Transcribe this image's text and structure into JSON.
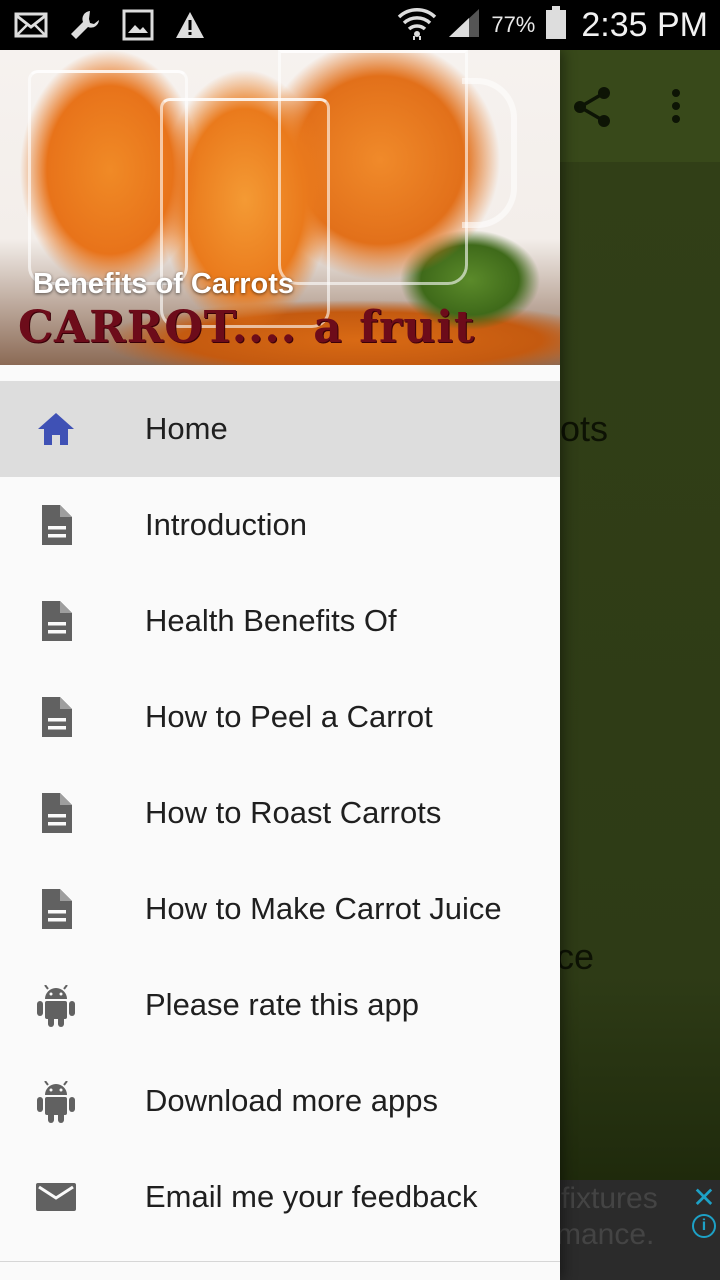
{
  "status_bar": {
    "icons_left": [
      "mail-icon",
      "wrench-icon",
      "image-icon",
      "warning-icon"
    ],
    "icons_right": [
      "wifi-icon",
      "signal-icon",
      "battery-icon"
    ],
    "battery": "77%",
    "time": "2:35 PM"
  },
  "background_app": {
    "toolbar_icons": [
      "share-icon",
      "more-vert-icon"
    ],
    "visible_text_1": "rots",
    "visible_text_2": "ice",
    "ad": {
      "line1": "l fixtures",
      "line2": "rmance.",
      "close_glyph": "✕",
      "info_glyph": "i"
    }
  },
  "drawer": {
    "header_title": "Benefits of Carrots",
    "header_logo_text": "CARROT.... a fruit",
    "items": [
      {
        "label": "Home",
        "icon": "home-icon"
      },
      {
        "label": "Introduction",
        "icon": "document-icon"
      },
      {
        "label": "Health Benefits Of",
        "icon": "document-icon"
      },
      {
        "label": "How to Peel a Carrot",
        "icon": "document-icon"
      },
      {
        "label": "How to Roast Carrots",
        "icon": "document-icon"
      },
      {
        "label": "How to Make Carrot Juice",
        "icon": "document-icon"
      },
      {
        "label": "Please rate this app",
        "icon": "android-icon"
      },
      {
        "label": "Download more apps",
        "icon": "android-icon"
      },
      {
        "label": "Email me your feedback",
        "icon": "email-icon"
      }
    ]
  },
  "colors": {
    "accent_home_icon": "#3f51b5",
    "toolbar": "#38491a",
    "icon_gray": "#616161"
  }
}
